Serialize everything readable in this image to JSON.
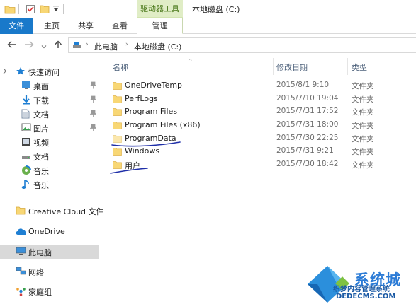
{
  "titlebar": {
    "tool_tab": "驱动器工具",
    "window_title": "本地磁盘 (C:)"
  },
  "ribbon": {
    "tabs": [
      {
        "label": "文件"
      },
      {
        "label": "主页"
      },
      {
        "label": "共享"
      },
      {
        "label": "查看"
      },
      {
        "label": "管理"
      }
    ]
  },
  "address": {
    "crumbs": [
      "此电脑",
      "本地磁盘 (C:)"
    ]
  },
  "sidebar": {
    "items": [
      {
        "label": "快速访问",
        "icon": "star-icon"
      },
      {
        "label": "桌面",
        "icon": "desktop-icon",
        "pinned": true
      },
      {
        "label": "下载",
        "icon": "download-icon",
        "pinned": true
      },
      {
        "label": "文档",
        "icon": "document-icon",
        "pinned": true
      },
      {
        "label": "图片",
        "icon": "picture-icon",
        "pinned": true
      },
      {
        "label": "视频",
        "icon": "video-icon"
      },
      {
        "label": "文档",
        "icon": "drive-icon"
      },
      {
        "label": "音乐",
        "icon": "music-disc-icon"
      },
      {
        "label": "音乐",
        "icon": "music-note-icon"
      },
      {
        "label": "Creative Cloud 文件",
        "icon": "creative-cloud-icon"
      },
      {
        "label": "OneDrive",
        "icon": "onedrive-icon"
      },
      {
        "label": "此电脑",
        "icon": "computer-icon",
        "selected": true
      },
      {
        "label": "网络",
        "icon": "network-icon"
      },
      {
        "label": "家庭组",
        "icon": "homegroup-icon"
      }
    ]
  },
  "columns": {
    "name": "名称",
    "date": "修改日期",
    "type": "类型"
  },
  "files": [
    {
      "name": "OneDriveTemp",
      "date": "2015/8/1 9:10",
      "type": "文件夹"
    },
    {
      "name": "PerfLogs",
      "date": "2015/7/10 19:04",
      "type": "文件夹"
    },
    {
      "name": "Program Files",
      "date": "2015/7/31 17:52",
      "type": "文件夹"
    },
    {
      "name": "Program Files (x86)",
      "date": "2015/7/31 18:00",
      "type": "文件夹"
    },
    {
      "name": "ProgramData",
      "date": "2015/7/30 22:25",
      "type": "文件夹"
    },
    {
      "name": "Windows",
      "date": "2015/7/31 9:21",
      "type": "文件夹"
    },
    {
      "name": "用户",
      "date": "2015/7/30 18:42",
      "type": "文件夹"
    }
  ],
  "watermark": {
    "big": "系统城",
    "line1": "织梦内容管理系统",
    "line2": "DEDECMS.COM"
  },
  "colors": {
    "accent": "#1979ca",
    "tool_tab_bg": "#e0edc6",
    "folder": "#f8d775",
    "annotation_ink": "#1f2fa8",
    "selected_bg": "#d9d9d9"
  }
}
